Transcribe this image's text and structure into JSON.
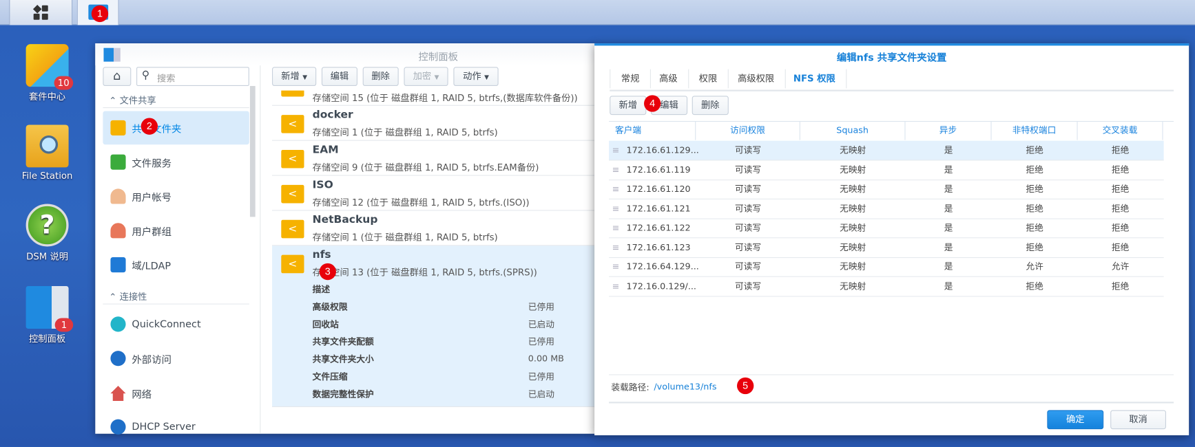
{
  "taskbar": {
    "items": [
      {
        "icon": "main-menu-icon"
      },
      {
        "icon": "control-panel-icon"
      }
    ]
  },
  "annotations": [
    "1",
    "2",
    "3",
    "4",
    "5"
  ],
  "desktop": {
    "icons": [
      {
        "label": "套件中心",
        "badge": "10"
      },
      {
        "label": "File Station"
      },
      {
        "label": "DSM 说明"
      },
      {
        "label": "控制面板",
        "badge": "1"
      }
    ]
  },
  "control_panel": {
    "title": "控制面板",
    "search_placeholder": "搜索",
    "sections": [
      {
        "label": "文件共享"
      },
      {
        "label": "连接性"
      }
    ],
    "sidebar": [
      {
        "label": "共享文件夹"
      },
      {
        "label": "文件服务"
      },
      {
        "label": "用户帐号"
      },
      {
        "label": "用户群组"
      },
      {
        "label": "域/LDAP"
      },
      {
        "label": "QuickConnect"
      },
      {
        "label": "外部访问"
      },
      {
        "label": "网络"
      },
      {
        "label": "DHCP Server"
      }
    ],
    "toolbar": {
      "create": "新增",
      "edit": "编辑",
      "delete": "删除",
      "encrypt": "加密",
      "action": "动作"
    },
    "folders": [
      {
        "name": "",
        "desc": "存储空间 15 (位于 磁盘群组 1, RAID 5, btrfs,(数据库软件备份))"
      },
      {
        "name": "docker",
        "desc": "存储空间 1 (位于 磁盘群组 1, RAID 5, btrfs)"
      },
      {
        "name": "EAM",
        "desc": "存储空间 9 (位于 磁盘群组 1, RAID 5, btrfs.EAM备份)"
      },
      {
        "name": "ISO",
        "desc": "存储空间 12 (位于 磁盘群组 1, RAID 5, btrfs.(ISO))"
      },
      {
        "name": "NetBackup",
        "desc": "存储空间 1 (位于 磁盘群组 1, RAID 5, btrfs)"
      },
      {
        "name": "nfs",
        "desc": "存储空间 13 (位于 磁盘群组 1, RAID 5, btrfs.(SPRS))"
      }
    ],
    "nfs_details": {
      "desc_label": "描述",
      "rows": [
        {
          "label": "高级权限",
          "value": "已停用"
        },
        {
          "label": "回收站",
          "value": "已启动"
        },
        {
          "label": "共享文件夹配额",
          "value": "已停用"
        },
        {
          "label": "共享文件夹大小",
          "value": "0.00 MB"
        },
        {
          "label": "文件压缩",
          "value": "已停用"
        },
        {
          "label": "数据完整性保护",
          "value": "已启动"
        }
      ]
    }
  },
  "dialog": {
    "title": "编辑nfs 共享文件夹设置",
    "tabs": [
      "常规",
      "高级",
      "权限",
      "高级权限",
      "NFS 权限"
    ],
    "active_tab": "NFS 权限",
    "buttons": {
      "create": "新增",
      "edit": "编辑",
      "delete": "删除"
    },
    "columns": [
      "客户端",
      "访问权限",
      "Squash",
      "异步",
      "非特权端口",
      "交叉装载"
    ],
    "rows": [
      [
        "172.16.61.129...",
        "可读写",
        "无映射",
        "是",
        "拒绝",
        "拒绝"
      ],
      [
        "172.16.61.119",
        "可读写",
        "无映射",
        "是",
        "拒绝",
        "拒绝"
      ],
      [
        "172.16.61.120",
        "可读写",
        "无映射",
        "是",
        "拒绝",
        "拒绝"
      ],
      [
        "172.16.61.121",
        "可读写",
        "无映射",
        "是",
        "拒绝",
        "拒绝"
      ],
      [
        "172.16.61.122",
        "可读写",
        "无映射",
        "是",
        "拒绝",
        "拒绝"
      ],
      [
        "172.16.61.123",
        "可读写",
        "无映射",
        "是",
        "拒绝",
        "拒绝"
      ],
      [
        "172.16.64.129...",
        "可读写",
        "无映射",
        "是",
        "允许",
        "允许"
      ],
      [
        "172.16.0.129/...",
        "可读写",
        "无映射",
        "是",
        "拒绝",
        "拒绝"
      ]
    ],
    "mount_path_label": "装载路径:",
    "mount_path": "/volume13/nfs",
    "ok": "确定",
    "cancel": "取消"
  }
}
